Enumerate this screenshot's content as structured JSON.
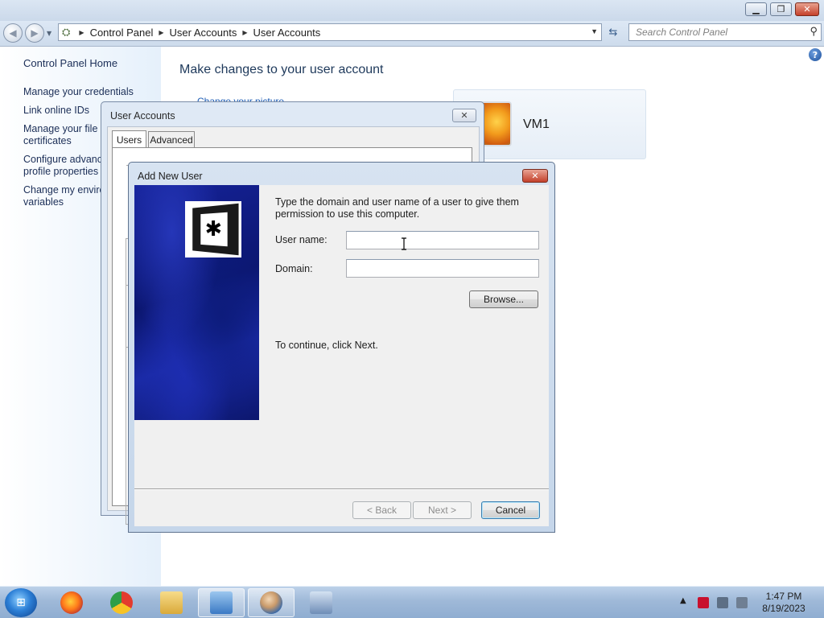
{
  "window": {
    "minimize_icon": "minimize-icon",
    "maximize_icon": "restore-icon",
    "close_icon": "close-icon"
  },
  "navbar": {
    "breadcrumbs": [
      "Control Panel",
      "User Accounts",
      "User Accounts"
    ],
    "search_placeholder": "Search Control Panel"
  },
  "sidebar": {
    "home": "Control Panel Home",
    "links": [
      {
        "line1": "Manage your credentials",
        "line2": ""
      },
      {
        "line1": "Link online IDs",
        "line2": ""
      },
      {
        "line1": "Manage your file e",
        "line2": "certificates"
      },
      {
        "line1": "Configure advanc",
        "line2": "profile properties"
      },
      {
        "line1": "Change my enviro",
        "line2": "variables"
      }
    ]
  },
  "main": {
    "title": "Make changes to your user account",
    "change_picture_link": "Change your picture",
    "user_name": "VM1"
  },
  "user_accounts_dialog": {
    "title": "User Accounts",
    "tabs": [
      "Users",
      "Advanced"
    ],
    "active_tab": "Users"
  },
  "add_new_user_dialog": {
    "title": "Add New User",
    "instructions": "Type the domain and user name of a user to give them permission to use this computer.",
    "user_name_label": "User name:",
    "user_name_value": "",
    "domain_label": "Domain:",
    "domain_value": "",
    "browse_button": "Browse...",
    "continue_text": "To continue, click Next.",
    "back_button": "< Back",
    "next_button": "Next >",
    "cancel_button": "Cancel"
  },
  "taskbar": {
    "items": [
      "start-button",
      "firefox",
      "chrome",
      "file-explorer",
      "control-panel",
      "user-accounts",
      "on-screen-keyboard"
    ],
    "clock_time": "1:47 PM",
    "clock_date": "8/19/2023"
  },
  "colors": {
    "link": "#1b2e57",
    "title": "#1e395b",
    "banner_blue": "#0b1670"
  }
}
